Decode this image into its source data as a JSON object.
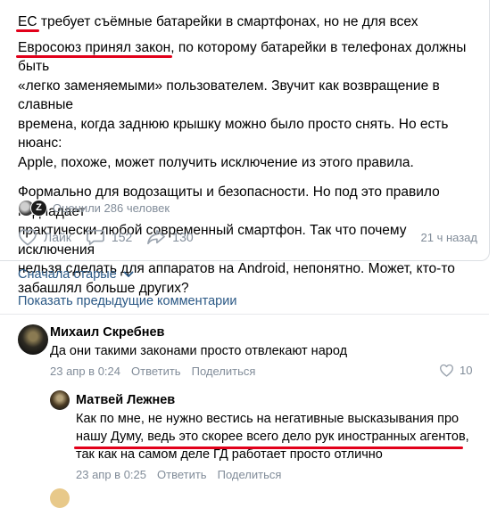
{
  "post": {
    "title_prefix": "ЕС",
    "title_rest": " требует съёмные батарейки в смартфонах, но не для всех",
    "p1_highlight": "Евросоюз принял закон",
    "p1_line1_rest": ", по которому батарейки в телефонах должны быть",
    "p1_line2": "«легко заменяемыми» пользователем. Звучит как возвращение в славные",
    "p1_line3": "времена, когда заднюю крышку можно было просто снять. Но есть нюанс:",
    "p1_line4": "Apple, похоже, может получить исключение из этого правила.",
    "p2_line1": "Формально для водозащиты и безопасности. Но под это правило подпадает",
    "p2_line2": "практически любой современный смартфон. Так что почему исключения",
    "p2_line3": "нельзя сделать для аппаратов на Android, непонятно. Может, кто-то",
    "p2_line4": "забашлял больше других?"
  },
  "rated": {
    "text": "Оценили 286 человек",
    "avatar2_letter": "Z"
  },
  "actions": {
    "like_label": "Лайк",
    "comments_count": "152",
    "shares_count": "130",
    "time": "21 ч назад"
  },
  "comments_header": {
    "sort_label": "Сначала старые",
    "show_prev_label": "Показать предыдущие комментарии"
  },
  "comments": [
    {
      "author": "Михаил Скребнев",
      "text": "Да они такими законами просто отвлекают народ",
      "date": "23 апр в 0:24",
      "reply": "Ответить",
      "share": "Поделиться",
      "likes": "10"
    },
    {
      "author": "Матвей Лежнев",
      "line1": "Как по мне, не нужно вестись на негативные высказывания про",
      "line2": "нашу Думу, ведь это скорее всего дело рук иностранных агентов,",
      "line3": "так как на самом деле ГД работает просто отлично",
      "date": "23 апр в 0:25",
      "reply": "Ответить",
      "share": "Поделиться"
    }
  ],
  "colors": {
    "link": "#2a5885",
    "muted": "#818c99",
    "underline": "#e2001a"
  }
}
